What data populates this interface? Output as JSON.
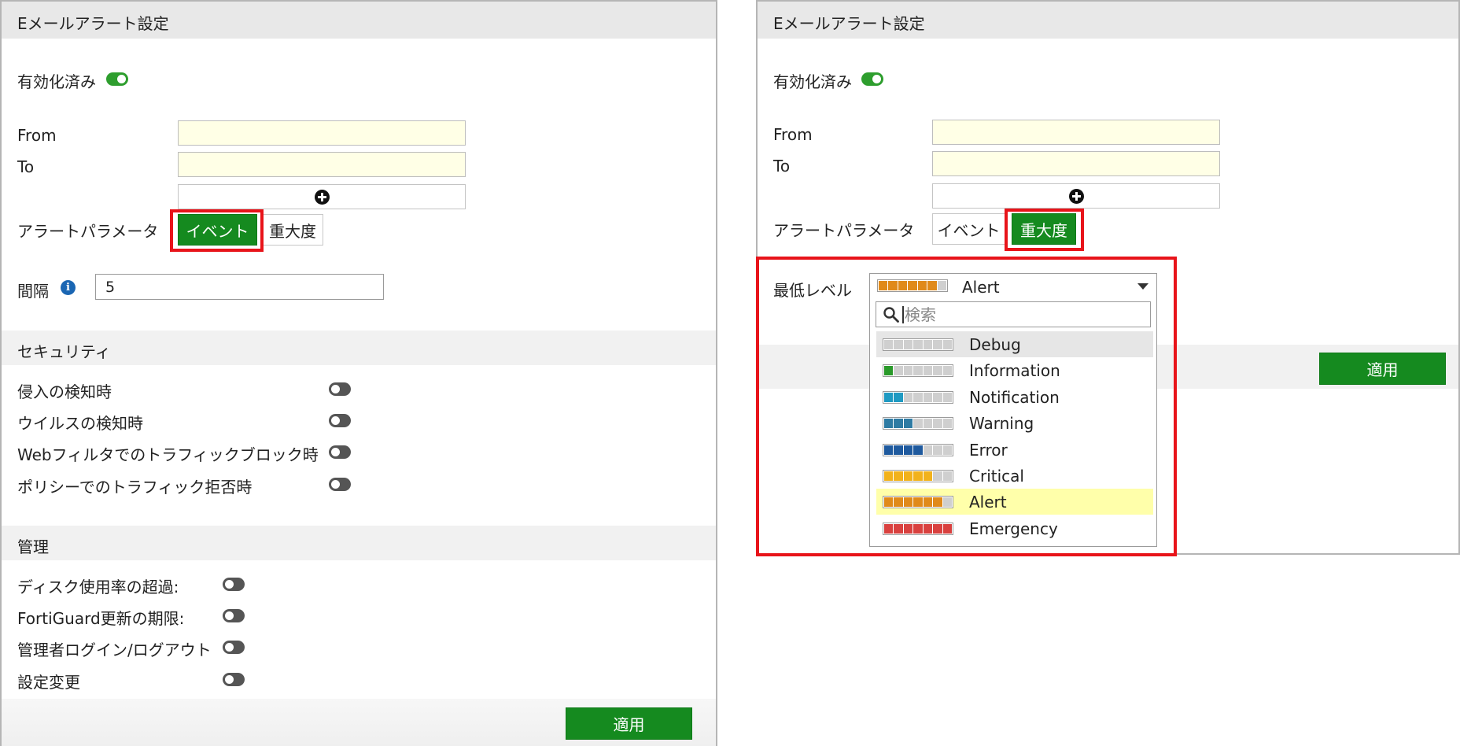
{
  "panel_title": "Eメールアラート設定",
  "left": {
    "enabled_label": "有効化済み",
    "from_label": "From",
    "to_label": "To",
    "alert_param_label": "アラートパラメータ",
    "event_button": "イベント",
    "severity_button": "重大度",
    "interval_label": "間隔",
    "interval_value": "5",
    "security_title": "セキュリティ",
    "security_items": [
      "侵入の検知時",
      "ウイルスの検知時",
      "Webフィルタでのトラフィックブロック時",
      "ポリシーでのトラフィック拒否時"
    ],
    "admin_title": "管理",
    "admin_items": [
      "ディスク使用率の超過:",
      "FortiGuard更新の期限:",
      "管理者ログイン/ログアウト",
      "設定変更"
    ],
    "apply_button": "適用"
  },
  "right": {
    "enabled_label": "有効化済み",
    "from_label": "From",
    "to_label": "To",
    "alert_param_label": "アラートパラメータ",
    "event_button": "イベント",
    "severity_button": "重大度",
    "min_level_label": "最低レベル",
    "selected_level": "Alert",
    "search_placeholder": "検索",
    "apply_button": "適用",
    "levels": [
      {
        "label": "Debug",
        "filled": 0,
        "color": "#cfcfcf"
      },
      {
        "label": "Information",
        "filled": 1,
        "color": "#2a9a2a"
      },
      {
        "label": "Notification",
        "filled": 2,
        "color": "#1f9ac2"
      },
      {
        "label": "Warning",
        "filled": 3,
        "color": "#2e7ba3"
      },
      {
        "label": "Error",
        "filled": 4,
        "color": "#1f5a9e"
      },
      {
        "label": "Critical",
        "filled": 5,
        "color": "#f2b21b"
      },
      {
        "label": "Alert",
        "filled": 6,
        "color": "#e08a1a"
      },
      {
        "label": "Emergency",
        "filled": 7,
        "color": "#d9413f"
      }
    ],
    "highlight_color": "#ffffaa",
    "hover_color": "#e6e6e6"
  },
  "colors": {
    "accent_green": "#158a1f",
    "highlight_red": "#e8141a"
  }
}
